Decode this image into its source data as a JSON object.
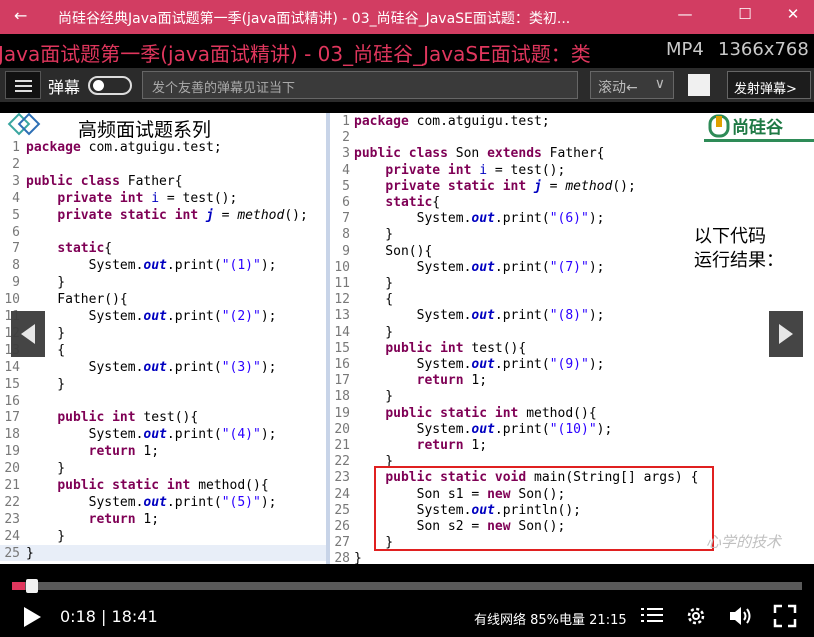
{
  "window": {
    "back_icon": "arrow-left-icon",
    "title": "尚硅谷经典Java面试题第一季(java面试精讲) - 03_尚硅谷_JavaSE面试题：类初...",
    "minimize": "—",
    "maximize": "☐",
    "close": "✕"
  },
  "overlay": {
    "filename": "Java面试题第一季(java面试精讲) - 03_尚硅谷_JavaSE面试题：类",
    "format": "MP4",
    "resolution": "1366x768"
  },
  "danmaku": {
    "label": "弹幕",
    "placeholder": "发个友善的弹幕见证当下",
    "mode": "滚动←",
    "mode_arrow": "∨",
    "send": "发射弹幕>"
  },
  "slide": {
    "series_title": "高频面试题系列",
    "brand": "尚硅谷",
    "question_line1": "以下代码",
    "question_line2": "运行结果：",
    "watermark": "心学的技术"
  },
  "left_code": {
    "line_numbers": [
      "1",
      "2",
      "3",
      "4",
      "5",
      "6",
      "7",
      "8",
      "9",
      "10",
      "11",
      "12",
      "13",
      "14",
      "15",
      "16",
      "17",
      "18",
      "19",
      "20",
      "21",
      "22",
      "23",
      "24",
      "25"
    ],
    "lines": [
      [
        {
          "t": "package",
          "c": "kw"
        },
        {
          "t": " com.atguigu.test;"
        }
      ],
      [],
      [
        {
          "t": "public class",
          "c": "kw"
        },
        {
          "t": " Father{"
        }
      ],
      [
        {
          "t": "    "
        },
        {
          "t": "private int",
          "c": "kw"
        },
        {
          "t": " "
        },
        {
          "t": "i",
          "c": "fld"
        },
        {
          "t": " = test();"
        }
      ],
      [
        {
          "t": "    "
        },
        {
          "t": "private static int",
          "c": "kw"
        },
        {
          "t": " "
        },
        {
          "t": "j",
          "c": "sm"
        },
        {
          "t": " = "
        },
        {
          "t": "method",
          "c": "it"
        },
        {
          "t": "();"
        }
      ],
      [],
      [
        {
          "t": "    "
        },
        {
          "t": "static",
          "c": "kw"
        },
        {
          "t": "{"
        }
      ],
      [
        {
          "t": "        System."
        },
        {
          "t": "out",
          "c": "sm"
        },
        {
          "t": ".print("
        },
        {
          "t": "\"(1)\"",
          "c": "st"
        },
        {
          "t": ");"
        }
      ],
      [
        {
          "t": "    }"
        }
      ],
      [
        {
          "t": "    Father(){"
        }
      ],
      [
        {
          "t": "        System."
        },
        {
          "t": "out",
          "c": "sm"
        },
        {
          "t": ".print("
        },
        {
          "t": "\"(2)\"",
          "c": "st"
        },
        {
          "t": ");"
        }
      ],
      [
        {
          "t": "    }"
        }
      ],
      [
        {
          "t": "    {"
        }
      ],
      [
        {
          "t": "        System."
        },
        {
          "t": "out",
          "c": "sm"
        },
        {
          "t": ".print("
        },
        {
          "t": "\"(3)\"",
          "c": "st"
        },
        {
          "t": ");"
        }
      ],
      [
        {
          "t": "    }"
        }
      ],
      [],
      [
        {
          "t": "    "
        },
        {
          "t": "public int",
          "c": "kw"
        },
        {
          "t": " test(){"
        }
      ],
      [
        {
          "t": "        System."
        },
        {
          "t": "out",
          "c": "sm"
        },
        {
          "t": ".print("
        },
        {
          "t": "\"(4)\"",
          "c": "st"
        },
        {
          "t": ");"
        }
      ],
      [
        {
          "t": "        "
        },
        {
          "t": "return",
          "c": "kw"
        },
        {
          "t": " 1;"
        }
      ],
      [
        {
          "t": "    }"
        }
      ],
      [
        {
          "t": "    "
        },
        {
          "t": "public static int",
          "c": "kw"
        },
        {
          "t": " method(){"
        }
      ],
      [
        {
          "t": "        System."
        },
        {
          "t": "out",
          "c": "sm"
        },
        {
          "t": ".print("
        },
        {
          "t": "\"(5)\"",
          "c": "st"
        },
        {
          "t": ");"
        }
      ],
      [
        {
          "t": "        "
        },
        {
          "t": "return",
          "c": "kw"
        },
        {
          "t": " 1;"
        }
      ],
      [
        {
          "t": "    }"
        }
      ],
      [
        {
          "t": "}"
        }
      ]
    ]
  },
  "right_code": {
    "line_numbers": [
      "1",
      "2",
      "3",
      "4",
      "5",
      "6",
      "7",
      "8",
      "9",
      "10",
      "11",
      "12",
      "13",
      "14",
      "15",
      "16",
      "17",
      "18",
      "19",
      "20",
      "21",
      "22",
      "23",
      "24",
      "25",
      "26",
      "27",
      "28"
    ],
    "lines": [
      [
        {
          "t": "package",
          "c": "kw"
        },
        {
          "t": " com.atguigu.test;"
        }
      ],
      [],
      [
        {
          "t": "public class",
          "c": "kw"
        },
        {
          "t": " Son "
        },
        {
          "t": "extends",
          "c": "kw"
        },
        {
          "t": " Father{"
        }
      ],
      [
        {
          "t": "    "
        },
        {
          "t": "private int",
          "c": "kw"
        },
        {
          "t": " "
        },
        {
          "t": "i",
          "c": "fld"
        },
        {
          "t": " = test();"
        }
      ],
      [
        {
          "t": "    "
        },
        {
          "t": "private static int",
          "c": "kw"
        },
        {
          "t": " "
        },
        {
          "t": "j",
          "c": "sm"
        },
        {
          "t": " = "
        },
        {
          "t": "method",
          "c": "it"
        },
        {
          "t": "();"
        }
      ],
      [
        {
          "t": "    "
        },
        {
          "t": "static",
          "c": "kw"
        },
        {
          "t": "{"
        }
      ],
      [
        {
          "t": "        System."
        },
        {
          "t": "out",
          "c": "sm"
        },
        {
          "t": ".print("
        },
        {
          "t": "\"(6)\"",
          "c": "st"
        },
        {
          "t": ");"
        }
      ],
      [
        {
          "t": "    }"
        }
      ],
      [
        {
          "t": "    Son(){"
        }
      ],
      [
        {
          "t": "        System."
        },
        {
          "t": "out",
          "c": "sm"
        },
        {
          "t": ".print("
        },
        {
          "t": "\"(7)\"",
          "c": "st"
        },
        {
          "t": ");"
        }
      ],
      [
        {
          "t": "    }"
        }
      ],
      [
        {
          "t": "    {"
        }
      ],
      [
        {
          "t": "        System."
        },
        {
          "t": "out",
          "c": "sm"
        },
        {
          "t": ".print("
        },
        {
          "t": "\"(8)\"",
          "c": "st"
        },
        {
          "t": ");"
        }
      ],
      [
        {
          "t": "    }"
        }
      ],
      [
        {
          "t": "    "
        },
        {
          "t": "public int",
          "c": "kw"
        },
        {
          "t": " test(){"
        }
      ],
      [
        {
          "t": "        System."
        },
        {
          "t": "out",
          "c": "sm"
        },
        {
          "t": ".print("
        },
        {
          "t": "\"(9)\"",
          "c": "st"
        },
        {
          "t": ");"
        }
      ],
      [
        {
          "t": "        "
        },
        {
          "t": "return",
          "c": "kw"
        },
        {
          "t": " 1;"
        }
      ],
      [
        {
          "t": "    }"
        }
      ],
      [
        {
          "t": "    "
        },
        {
          "t": "public static int",
          "c": "kw"
        },
        {
          "t": " method(){"
        }
      ],
      [
        {
          "t": "        System."
        },
        {
          "t": "out",
          "c": "sm"
        },
        {
          "t": ".print("
        },
        {
          "t": "\"(10)\"",
          "c": "st"
        },
        {
          "t": ");"
        }
      ],
      [
        {
          "t": "        "
        },
        {
          "t": "return",
          "c": "kw"
        },
        {
          "t": " 1;"
        }
      ],
      [
        {
          "t": "    }"
        }
      ],
      [
        {
          "t": "    "
        },
        {
          "t": "public static void",
          "c": "kw"
        },
        {
          "t": " main(String[] args) {"
        }
      ],
      [
        {
          "t": "        Son s1 = "
        },
        {
          "t": "new",
          "c": "kw"
        },
        {
          "t": " Son();"
        }
      ],
      [
        {
          "t": "        System."
        },
        {
          "t": "out",
          "c": "sm"
        },
        {
          "t": ".println();"
        }
      ],
      [
        {
          "t": "        Son s2 = "
        },
        {
          "t": "new",
          "c": "kw"
        },
        {
          "t": " Son();"
        }
      ],
      [
        {
          "t": "    }"
        }
      ],
      [
        {
          "t": "}"
        }
      ]
    ]
  },
  "player": {
    "progress_fraction": 0.016,
    "current_time": "0:18",
    "separator": "|",
    "total_time": "18:41",
    "status": "有线网络 85%电量 21:15"
  },
  "colors": {
    "title_bar": "#d23d62",
    "accent": "#e0365d",
    "highlight_box": "#e02020",
    "keyword": "#7f0055",
    "string": "#2a00ff"
  }
}
